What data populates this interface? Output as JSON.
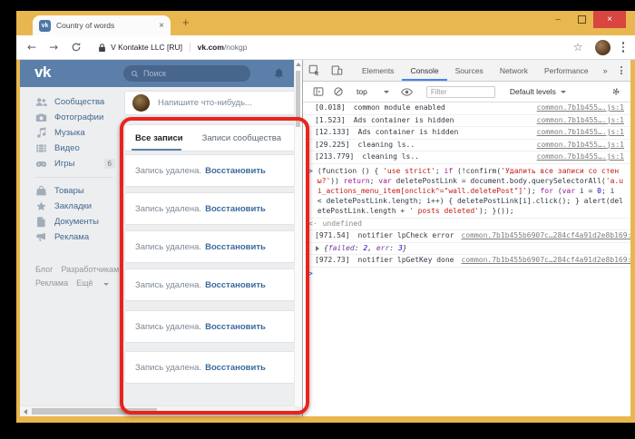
{
  "browser": {
    "tab_title": "Country of words",
    "favicon_text": "vk",
    "security_label": "V Kontakte LLC [RU]",
    "url_host": "vk.com",
    "url_path": "/nokgp"
  },
  "vk": {
    "logo_text": "vk",
    "search_placeholder": "Поиск",
    "composer_placeholder": "Напишите что-нибудь...",
    "sidebar_items": [
      {
        "label": "Сообщества"
      },
      {
        "label": "Фотографии"
      },
      {
        "label": "Музыка"
      },
      {
        "label": "Видео"
      },
      {
        "label": "Игры",
        "badge": "6"
      },
      {
        "label": "Товары"
      },
      {
        "label": "Закладки"
      },
      {
        "label": "Документы"
      },
      {
        "label": "Реклама"
      }
    ],
    "footer": {
      "blog": "Блог",
      "developers": "Разработчикам",
      "ads": "Реклама",
      "more": "Ещё"
    },
    "wall": {
      "tab_all": "Все записи",
      "tab_community": "Записи сообщества",
      "deleted_text": "Запись удалена.",
      "restore_label": "Восстановить"
    }
  },
  "devtools": {
    "tabs": {
      "elements": "Elements",
      "console": "Console",
      "sources": "Sources",
      "network": "Network",
      "performance": "Performance",
      "more": "»"
    },
    "toolbar": {
      "context": "top",
      "filter_placeholder": "Filter",
      "levels": "Default levels"
    },
    "console": {
      "logs": [
        {
          "time": "[0.018]",
          "message": "common module enabled",
          "source": "common.7b1b455….js:1"
        },
        {
          "time": "[1.523]",
          "message": "Ads container is hidden",
          "source": "common.7b1b455….js:1"
        },
        {
          "time": "[12.133]",
          "message": "Ads container is hidden",
          "source": "common.7b1b455….js:1"
        },
        {
          "time": "[29.225]",
          "message": "cleaning ls..",
          "source": "common.7b1b455….js:1"
        },
        {
          "time": "[213.779]",
          "message": "cleaning ls..",
          "source": "common.7b1b455….js:1"
        }
      ],
      "input_marker": ">",
      "result_marker": "<·",
      "result_value": "undefined",
      "code_segments": [
        {
          "text": "(function () { ",
          "cls": "d"
        },
        {
          "text": "'use strict'",
          "cls": "s"
        },
        {
          "text": "; ",
          "cls": "d"
        },
        {
          "text": "if",
          "cls": "k"
        },
        {
          "text": " (!confirm(",
          "cls": "d"
        },
        {
          "text": "'Удалить все записи со стены?'",
          "cls": "s"
        },
        {
          "text": ")) ",
          "cls": "d"
        },
        {
          "text": "return",
          "cls": "k"
        },
        {
          "text": "; ",
          "cls": "d"
        },
        {
          "text": "var",
          "cls": "k"
        },
        {
          "text": " deletePostLink = document.body.querySelectorAll(",
          "cls": "d"
        },
        {
          "text": "'a.ui_actions_menu_item[onclick^=\"wall.deletePost\"]'",
          "cls": "s"
        },
        {
          "text": "); ",
          "cls": "d"
        },
        {
          "text": "for",
          "cls": "k"
        },
        {
          "text": " (",
          "cls": "d"
        },
        {
          "text": "var",
          "cls": "k"
        },
        {
          "text": " i = ",
          "cls": "d"
        },
        {
          "text": "0",
          "cls": "n"
        },
        {
          "text": "; i < deletePostLink.length; i++) { deletePostLink[i].click(); } alert(deletePostLink.length + ",
          "cls": "d"
        },
        {
          "text": "' posts deleted'",
          "cls": "s"
        },
        {
          "text": "); }());",
          "cls": "d"
        }
      ],
      "late_logs": [
        {
          "time": "[971.54]",
          "message": "notifier lpCheck error",
          "source": "common.7b1b455b6907c…284cf4a91d2e8b169:1"
        },
        {
          "time": "[972.73]",
          "message": "notifier lpGetKey done",
          "source": "common.7b1b455b6907c…284cf4a91d2e8b169:1"
        }
      ],
      "object_preview_segments": [
        {
          "text": "{",
          "cls": "d"
        },
        {
          "text": "failed",
          "cls": "key"
        },
        {
          "text": ": ",
          "cls": "d"
        },
        {
          "text": "2",
          "cls": "n"
        },
        {
          "text": ", ",
          "cls": "d"
        },
        {
          "text": "err",
          "cls": "key"
        },
        {
          "text": ": ",
          "cls": "d"
        },
        {
          "text": "3",
          "cls": "n"
        },
        {
          "text": "}",
          "cls": "d"
        }
      ]
    }
  }
}
